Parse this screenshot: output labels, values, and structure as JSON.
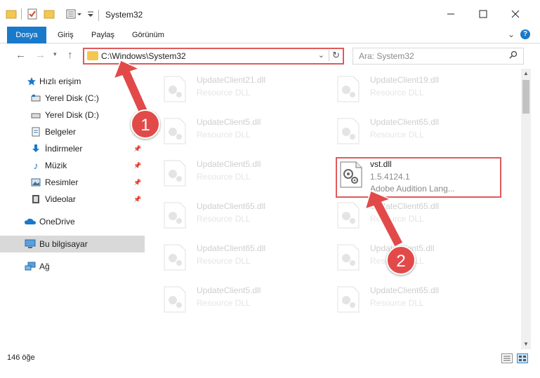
{
  "window": {
    "title": "System32",
    "minimize_icon": "minimize-icon",
    "maximize_icon": "maximize-icon",
    "close_icon": "close-icon"
  },
  "ribbon": {
    "tabs": [
      "Dosya",
      "Giriş",
      "Paylaş",
      "Görünüm"
    ],
    "accent": "#1979ca"
  },
  "nav": {
    "address": "C:\\Windows\\System32",
    "search_placeholder": "Ara: System32"
  },
  "sidebar": {
    "items": [
      {
        "label": "Hızlı erişim",
        "icon": "star-icon"
      },
      {
        "label": "Yerel Disk (C:)",
        "icon": "drive-icon"
      },
      {
        "label": "Yerel Disk (D:)",
        "icon": "drive-icon"
      },
      {
        "label": "Belgeler",
        "icon": "documents-icon"
      },
      {
        "label": "İndirmeler",
        "icon": "download-icon"
      },
      {
        "label": "Müzik",
        "icon": "music-icon"
      },
      {
        "label": "Resimler",
        "icon": "pictures-icon"
      },
      {
        "label": "Videolar",
        "icon": "video-icon"
      },
      {
        "label": "OneDrive",
        "icon": "cloud-icon"
      },
      {
        "label": "Bu bilgisayar",
        "icon": "computer-icon"
      },
      {
        "label": "Ağ",
        "icon": "network-icon"
      }
    ]
  },
  "files": {
    "left": [
      {
        "name": "UpdateClient21.dll",
        "type": "Resource DLL"
      },
      {
        "name": "UpdateClient5.dll",
        "type": "Resource DLL"
      },
      {
        "name": "UpdateClient5.dll",
        "type": "Resource DLL"
      },
      {
        "name": "UpdateClient65.dll",
        "type": "Resource DLL"
      },
      {
        "name": "UpdateClient65.dll",
        "type": "Resource DLL"
      },
      {
        "name": "UpdateClient5.dll",
        "type": "Resource DLL"
      }
    ],
    "right": [
      {
        "name": "UpdateClient19.dll",
        "type": "Resource DLL"
      },
      {
        "name": "UpdateClient65.dll",
        "type": "Resource DLL"
      },
      {
        "name": "vst.dll",
        "version": "1.5.4124.1",
        "description": "Adobe Audition Lang..."
      },
      {
        "name": "UpdateClient65.dll",
        "type": "Resource DLL"
      },
      {
        "name": "UpdateClient5.dll",
        "type": "Resource DLL"
      },
      {
        "name": "UpdateClient65.dll",
        "type": "Resource DLL"
      }
    ]
  },
  "status": {
    "count": "146 öğe"
  },
  "annotations": {
    "marker1": "1",
    "marker2": "2",
    "color": "#e24a4a"
  }
}
